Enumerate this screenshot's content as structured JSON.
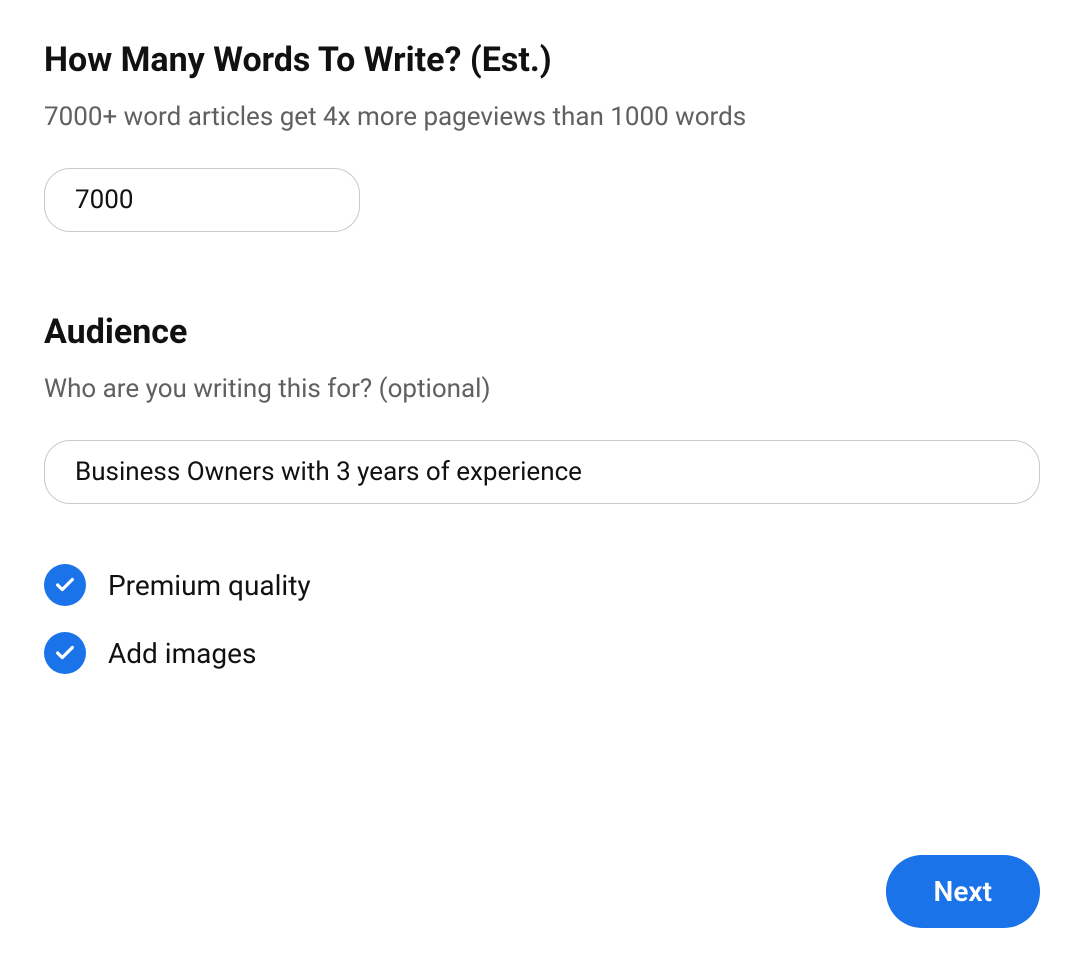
{
  "words": {
    "title": "How Many Words To Write? (Est.)",
    "subtitle": "7000+ word articles get 4x more pageviews than 1000 words",
    "value": "7000"
  },
  "audience": {
    "title": "Audience",
    "subtitle": "Who are you writing this for? (optional)",
    "value": "Business Owners with 3 years of experience"
  },
  "checkboxes": {
    "premium_label": "Premium quality",
    "images_label": "Add images"
  },
  "buttons": {
    "next_label": "Next"
  }
}
